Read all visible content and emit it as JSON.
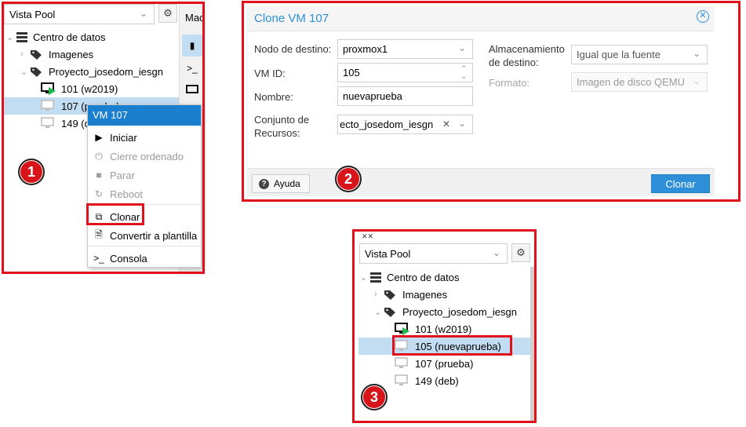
{
  "panel1": {
    "view_select": "Vista Pool",
    "tab_label": "Mac",
    "tree": {
      "datacenter": "Centro de datos",
      "images": "Imagenes",
      "project": "Proyecto_josedom_iesgn",
      "vm_101": "101 (w2019)",
      "vm_107": "107 (prueba)",
      "vm_149": "149 (d"
    },
    "context_menu": {
      "title": "VM 107",
      "items": [
        "Iniciar",
        "Cierre ordenado",
        "Parar",
        "Reboot",
        "Clonar",
        "Convertir a plantilla",
        "Consola"
      ]
    },
    "badge": "1"
  },
  "dialog": {
    "title": "Clone VM 107",
    "target_node_label": "Nodo de destino:",
    "target_node_value": "proxmox1",
    "vmid_label": "VM ID:",
    "vmid_value": "105",
    "name_label": "Nombre:",
    "name_value": "nuevaprueba",
    "pool_label": "Conjunto de Recursos:",
    "pool_value": "ecto_josedom_iesgn",
    "storage_label": "Almacenamiento de destino:",
    "storage_value": "Igual que la fuente",
    "format_label": "Formato:",
    "format_value": "Imagen de disco QEMU",
    "help_button": "Ayuda",
    "clone_button": "Clonar",
    "badge": "2"
  },
  "panel3": {
    "view_select": "Vista Pool",
    "tree": {
      "datacenter": "Centro de datos",
      "images": "Imagenes",
      "project": "Proyecto_josedom_iesgn",
      "vm_101": "101 (w2019)",
      "vm_105": "105 (nuevaprueba)",
      "vm_107": "107 (prueba)",
      "vm_149": "149 (deb)"
    },
    "badge": "3"
  },
  "colors": {
    "highlight_red": "#e0111c",
    "accent_blue": "#2e8fd8",
    "menu_header_blue": "#1b7fd0",
    "selection_blue": "#c2ddf2",
    "running_green": "#1fb84b"
  }
}
